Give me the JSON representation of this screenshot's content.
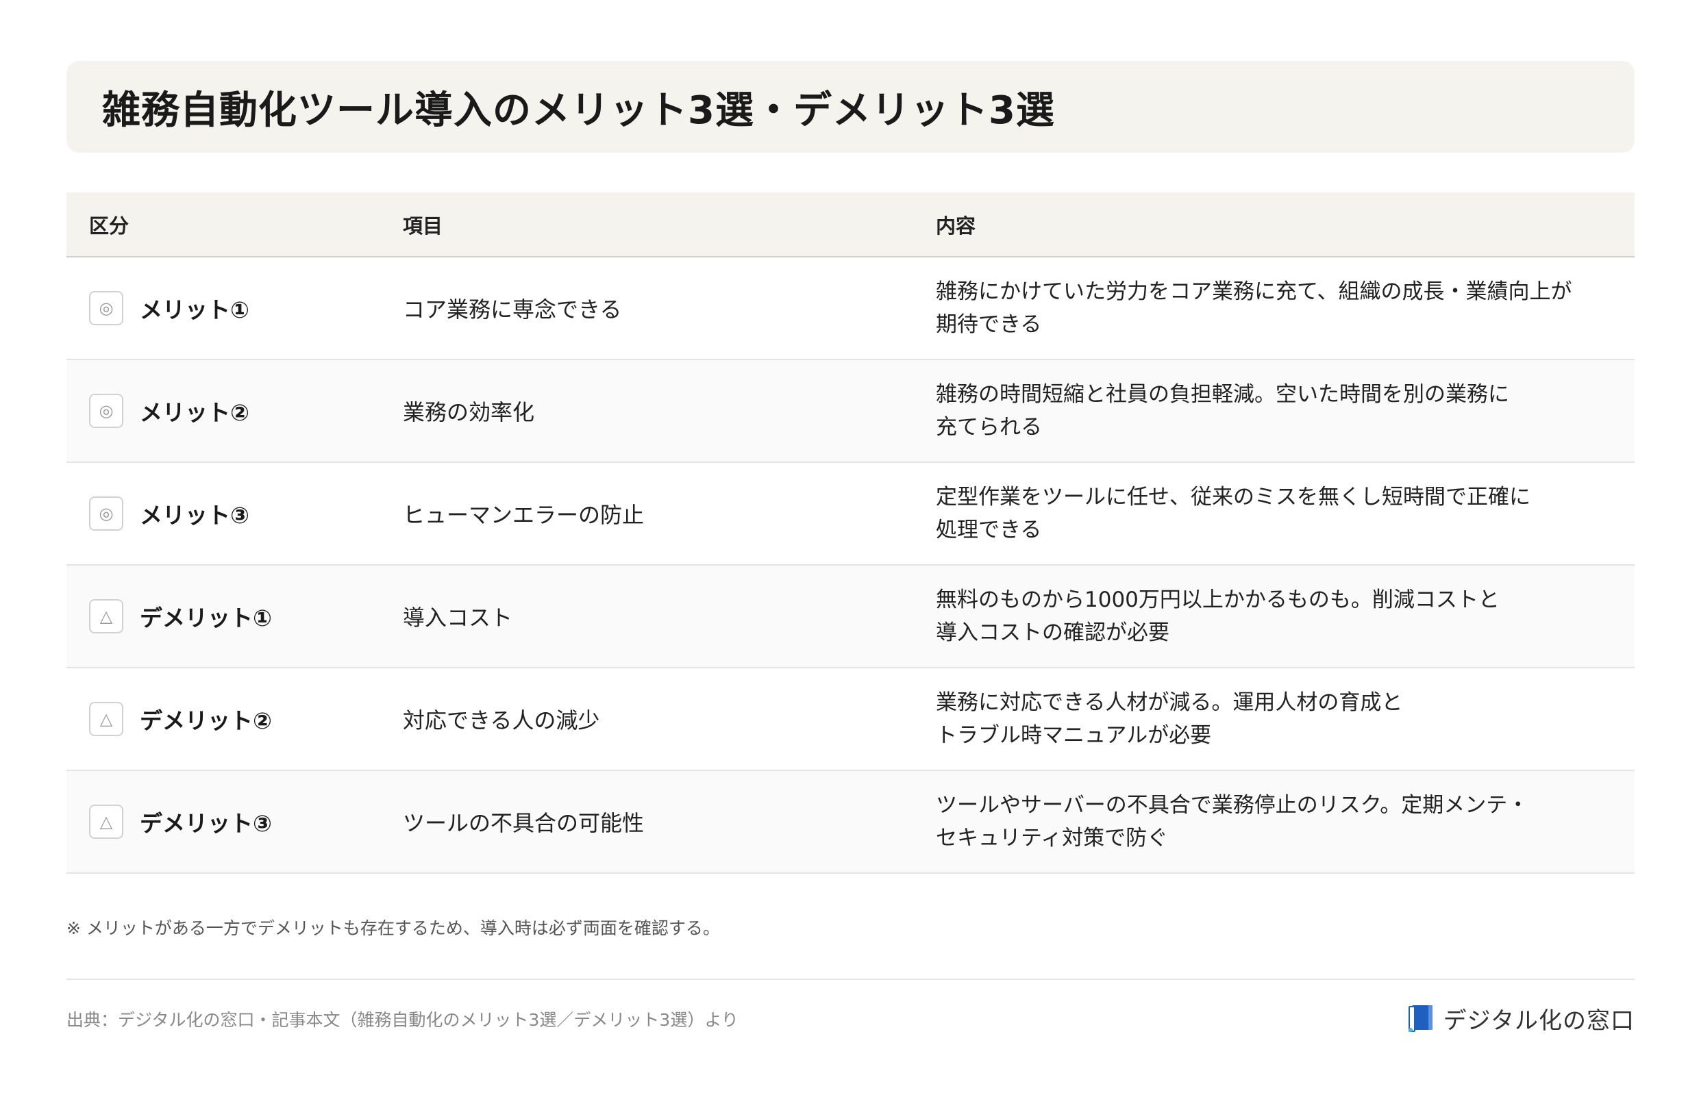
{
  "title": "雑務自動化ツール導入のメリット3選・デメリット3選",
  "table": {
    "headers": [
      "区分",
      "項目",
      "内容"
    ],
    "rows": [
      {
        "badge": "◎",
        "category": "メリット①",
        "item": "コア業務に専念できる",
        "content_line1": "雑務にかけていた労力をコア業務に充て、組織の成長・業績向上が",
        "content_line2": "期待できる"
      },
      {
        "badge": "◎",
        "category": "メリット②",
        "item": "業務の効率化",
        "content_line1": "雑務の時間短縮と社員の負担軽減。空いた時間を別の業務に",
        "content_line2": "充てられる"
      },
      {
        "badge": "◎",
        "category": "メリット③",
        "item": "ヒューマンエラーの防止",
        "content_line1": "定型作業をツールに任せ、従来のミスを無くし短時間で正確に",
        "content_line2": "処理できる"
      },
      {
        "badge": "△",
        "category": "デメリット①",
        "item": "導入コスト",
        "content_line1": "無料のものから1000万円以上かかるものも。削減コストと",
        "content_line2": "導入コストの確認が必要"
      },
      {
        "badge": "△",
        "category": "デメリット②",
        "item": "対応できる人の減少",
        "content_line1": "業務に対応できる人材が減る。運用人材の育成と",
        "content_line2": "トラブル時マニュアルが必要"
      },
      {
        "badge": "△",
        "category": "デメリット③",
        "item": "ツールの不具合の可能性",
        "content_line1": "ツールやサーバーの不具合で業務停止のリスク。定期メンテ・",
        "content_line2": "セキュリティ対策で防ぐ"
      }
    ]
  },
  "note": "※ メリットがある一方でデメリットも存在するため、導入時は必ず両面を確認する。",
  "source": "出典：デジタル化の窓口・記事本文（雑務自動化のメリット3選／デメリット3選）より",
  "logo": {
    "text": "デジタル化の窓口",
    "icon": "book-logo-icon",
    "color": "#1f5fbf"
  }
}
